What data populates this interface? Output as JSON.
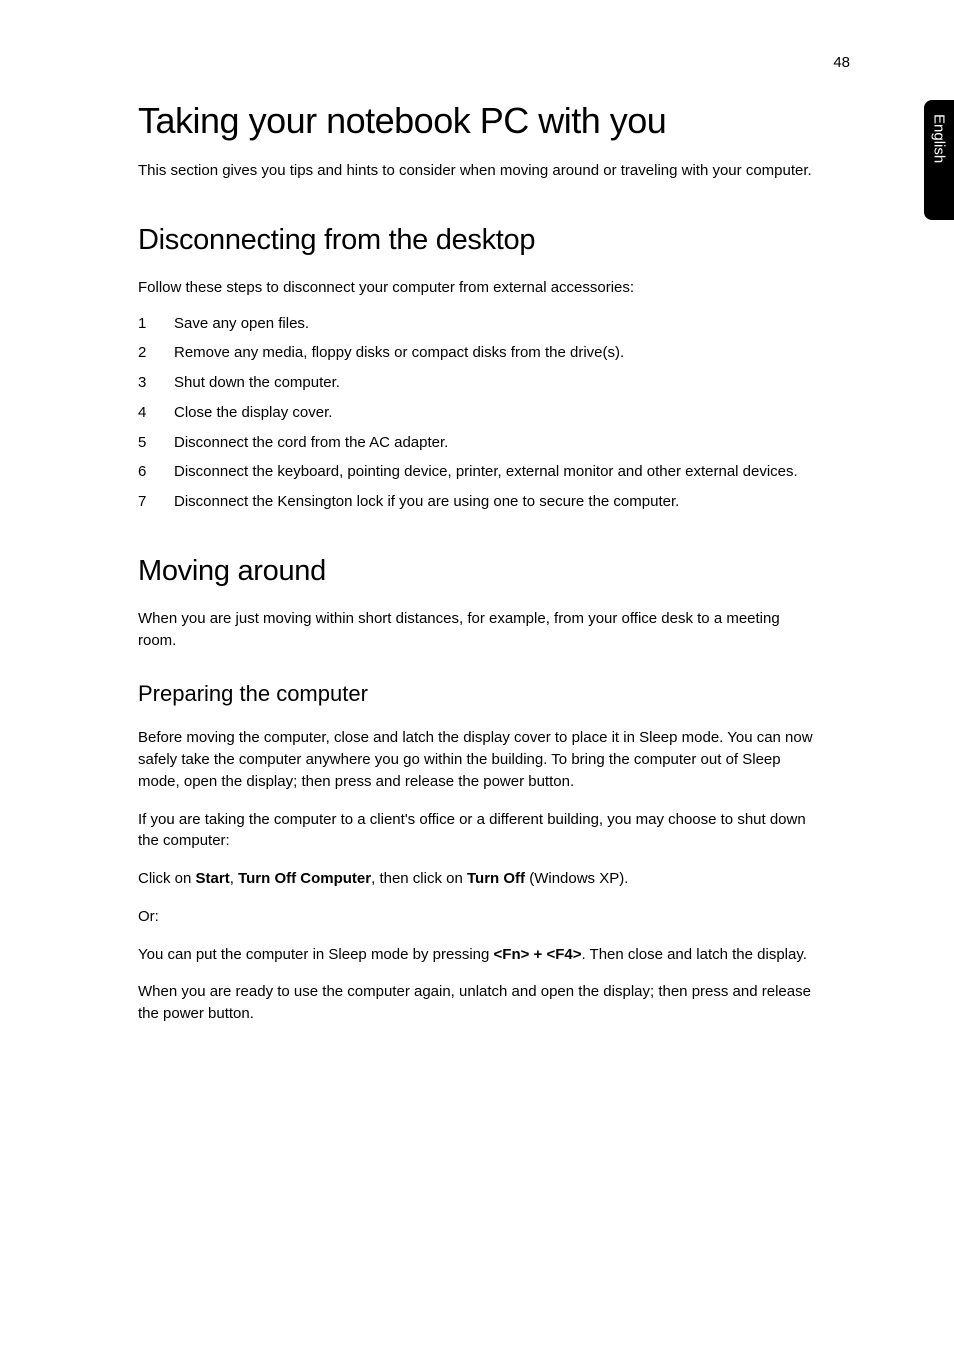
{
  "page_number": "48",
  "side_tab": "English",
  "h1": "Taking your notebook PC with you",
  "intro": "This section gives you tips and hints to consider when moving around or traveling with your computer.",
  "section1": {
    "heading": "Disconnecting from the desktop",
    "intro": "Follow these steps to disconnect your computer from external accessories:",
    "steps": [
      {
        "num": "1",
        "text": "Save any open files."
      },
      {
        "num": "2",
        "text": "Remove any media, floppy disks or compact disks from the drive(s)."
      },
      {
        "num": "3",
        "text": "Shut down the computer."
      },
      {
        "num": "4",
        "text": "Close the display cover."
      },
      {
        "num": "5",
        "text": "Disconnect the cord from the AC adapter."
      },
      {
        "num": "6",
        "text": "Disconnect the keyboard, pointing device, printer, external monitor and other external devices."
      },
      {
        "num": "7",
        "text": "Disconnect the Kensington lock if you are using one to secure the computer."
      }
    ]
  },
  "section2": {
    "heading": "Moving around",
    "intro": "When you are just moving within short distances, for example, from your office desk to a meeting room.",
    "sub1": {
      "heading": "Preparing the computer",
      "p1": "Before moving the computer, close and latch the display cover to place it in Sleep mode. You can now safely take the computer anywhere you go within the building. To bring the computer out of Sleep mode, open the display; then press and release the power button.",
      "p2": "If you are taking the computer to a client's office or a different building, you may choose to shut down the computer:",
      "p3_prefix": "Click on ",
      "p3_b1": "Start",
      "p3_sep1": ", ",
      "p3_b2": "Turn Off Computer",
      "p3_mid": ", then click on ",
      "p3_b3": "Turn Off",
      "p3_suffix": " (Windows XP).",
      "p4": "Or:",
      "p5_prefix": "You can put the computer in Sleep mode by pressing ",
      "p5_b1": "<Fn> + <F4>",
      "p5_suffix": ". Then close and latch the display.",
      "p6": "When you are ready to use the computer again, unlatch and open the display; then press and release the power button."
    }
  }
}
